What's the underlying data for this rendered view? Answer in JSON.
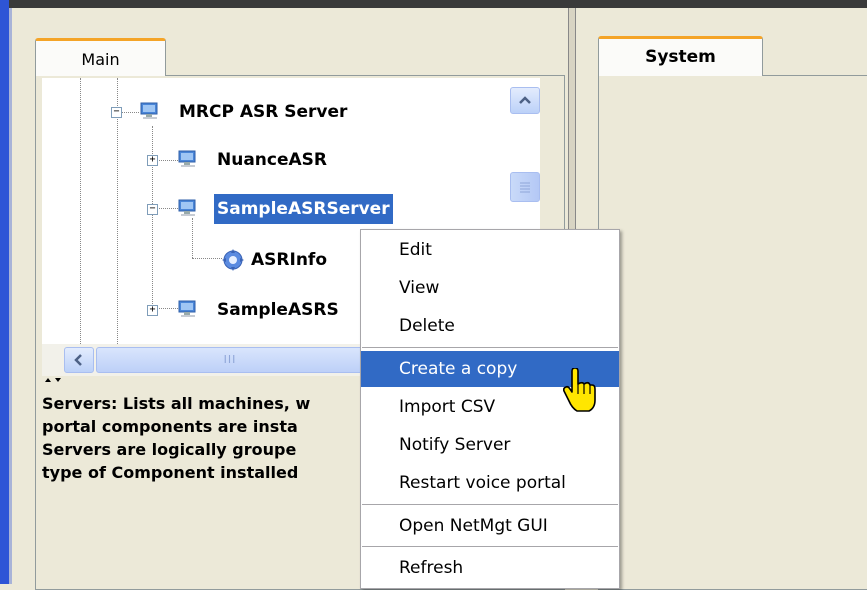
{
  "tabs": {
    "left_main": "Main",
    "right_system": "System"
  },
  "tree": {
    "nodes": [
      {
        "label": "MRCP ASR Server",
        "expander": "−"
      },
      {
        "label": "NuanceASR",
        "expander": "+"
      },
      {
        "label": "SampleASRServer",
        "expander": "−",
        "selected": true
      },
      {
        "label": "ASRInfo",
        "icon": "gear-icon"
      },
      {
        "label": "SampleASRS",
        "expander": "+"
      }
    ]
  },
  "hscroll_grip": "III",
  "description": {
    "lines": [
      "Servers: Lists all machines, w",
      "portal components are insta",
      "Servers are logically groupe",
      "type of Component installed"
    ]
  },
  "context_menu": {
    "items": [
      {
        "label": "Edit"
      },
      {
        "label": "View"
      },
      {
        "label": "Delete"
      },
      {
        "label": "Create a copy",
        "highlighted": true
      },
      {
        "label": "Import CSV"
      },
      {
        "label": "Notify Server"
      },
      {
        "label": "Restart voice portal"
      },
      {
        "label": "Open NetMgt GUI"
      },
      {
        "label": "Refresh"
      }
    ]
  },
  "colors": {
    "selection": "#316ac5",
    "tab_accent": "#f4a428",
    "window_bg": "#ece9d8"
  }
}
